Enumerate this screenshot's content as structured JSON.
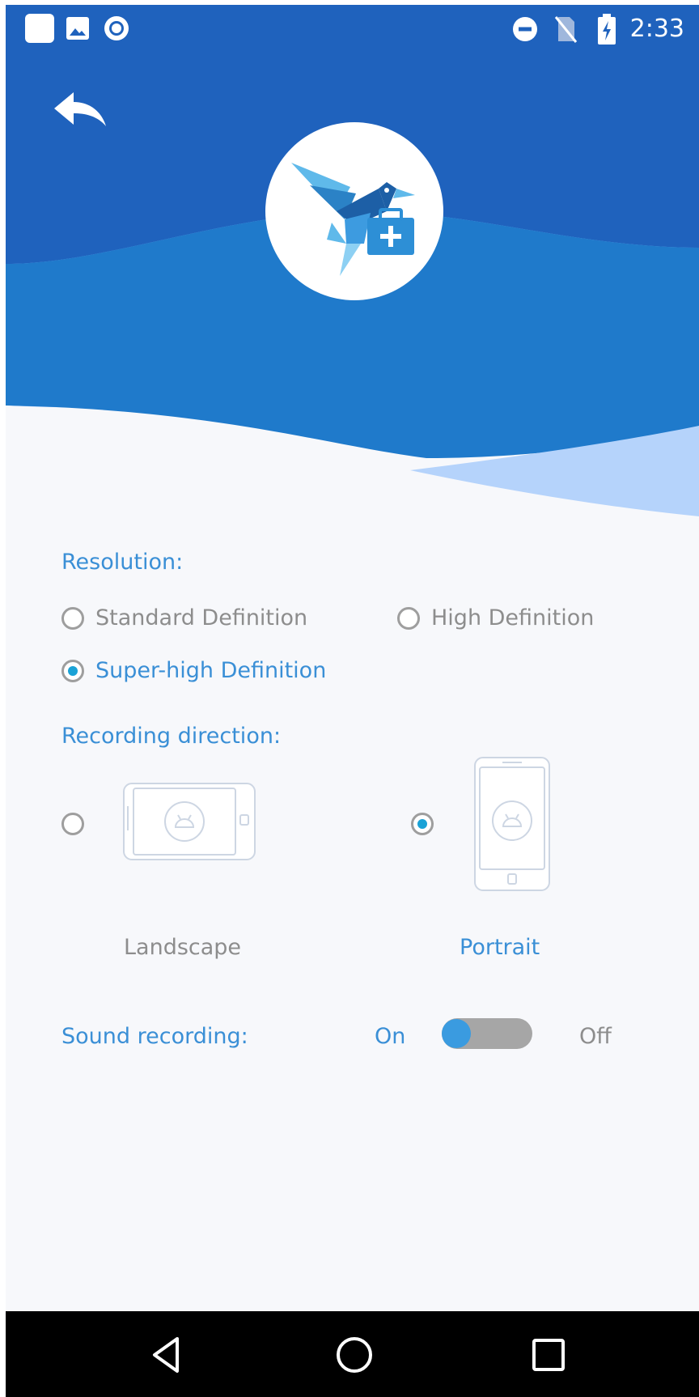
{
  "status_bar": {
    "time": "2:33",
    "left_icons": [
      "app-square-icon",
      "image-icon",
      "record-dot-icon"
    ],
    "right_icons": [
      "do-not-disturb-icon",
      "no-sim-icon",
      "battery-charging-icon"
    ]
  },
  "colors": {
    "header_dark": "#1f62bd",
    "header_mid": "#1f7acb",
    "wave_light": "#7fb5f7",
    "wave_lighter": "#b5d3fb",
    "accent_text": "#3a8fd6",
    "radio_checked": "#1aa2d6",
    "toggle_track": "#a6a6a6",
    "toggle_knob": "#3a9be0"
  },
  "settings": {
    "resolution": {
      "label": "Resolution:",
      "options": [
        {
          "label": "Standard Definition",
          "selected": false
        },
        {
          "label": "High Definition",
          "selected": false
        },
        {
          "label": "Super-high Definition",
          "selected": true
        }
      ]
    },
    "direction": {
      "label": "Recording direction:",
      "options": [
        {
          "label": "Landscape",
          "selected": false
        },
        {
          "label": "Portrait",
          "selected": true
        }
      ]
    },
    "sound": {
      "label": "Sound recording:",
      "on_label": "On",
      "off_label": "Off",
      "state": "On"
    }
  },
  "nav_bar": {
    "buttons": [
      "back-triangle-icon",
      "home-circle-icon",
      "recents-square-icon"
    ]
  }
}
